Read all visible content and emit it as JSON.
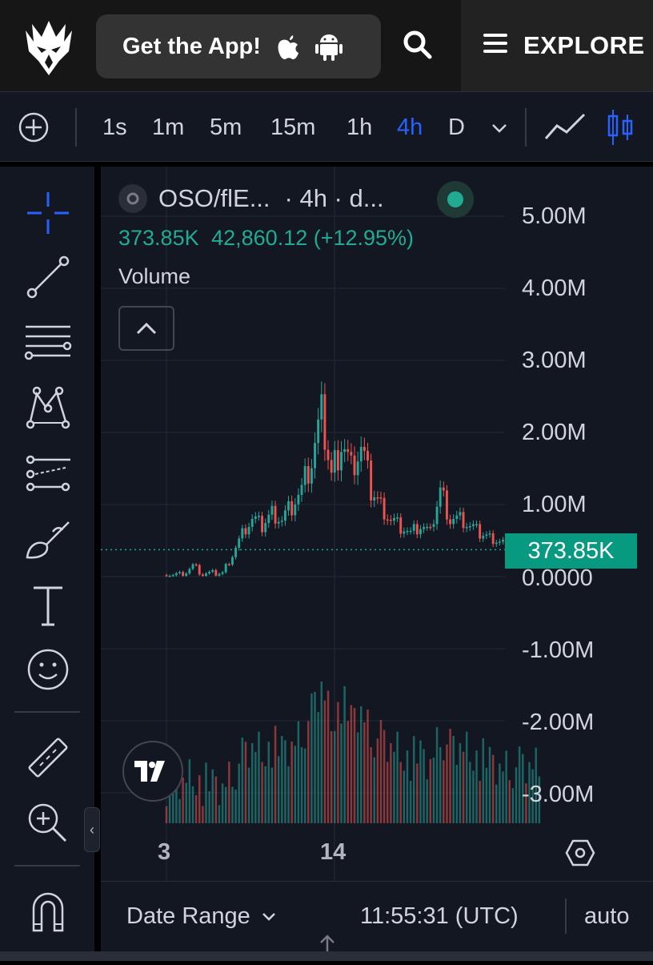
{
  "header": {
    "get_app_label": "Get the App!",
    "explore_label": "EXPLORE"
  },
  "toolbar": {
    "timeframes": [
      "1s",
      "1m",
      "5m",
      "15m",
      "1h",
      "4h",
      "D"
    ],
    "active_timeframe": "4h"
  },
  "legend": {
    "symbol": "OSO/flE...",
    "interval_exchange": "· 4h · d...",
    "last_value": "373.85K",
    "change": "42,860.12 (+12.95%)",
    "indicator": "Volume"
  },
  "price_axis": {
    "labels": [
      "5.00M",
      "4.00M",
      "3.00M",
      "2.00M",
      "1.00M",
      "0.0000",
      "-1.00M",
      "-2.00M",
      "-3.00M"
    ],
    "current_price_tag": "373.85K"
  },
  "time_axis": {
    "labels": [
      "3",
      "14"
    ]
  },
  "bottom_bar": {
    "date_range_label": "Date Range",
    "clock": "11:55:31 (UTC)",
    "scale_mode": "auto"
  },
  "colors": {
    "up": "#26a69a",
    "down": "#ef5350",
    "accent": "#2962ff",
    "background": "#131722"
  },
  "chart_data": {
    "type": "candlestick",
    "y_axis_labels": [
      "5.00M",
      "4.00M",
      "3.00M",
      "2.00M",
      "1.00M",
      "0.0000",
      "-1.00M",
      "-2.00M",
      "-3.00M"
    ],
    "x_axis_labels": [
      "3",
      "14"
    ],
    "current_value": 373850,
    "price_series_approx": [
      0.02,
      0.03,
      0.02,
      0.15,
      0.03,
      0.04,
      0.05,
      0.3,
      0.6,
      0.8,
      0.7,
      0.9,
      0.8,
      1.0,
      1.2,
      1.6,
      2.2,
      1.4,
      1.9,
      1.5,
      1.8,
      1.2,
      1.0,
      0.8,
      0.7,
      0.6,
      0.7,
      0.6,
      1.2,
      0.8,
      0.8,
      0.7,
      0.6,
      0.55,
      0.5,
      0.45,
      0.4,
      0.37
    ],
    "y_unit": "M"
  }
}
